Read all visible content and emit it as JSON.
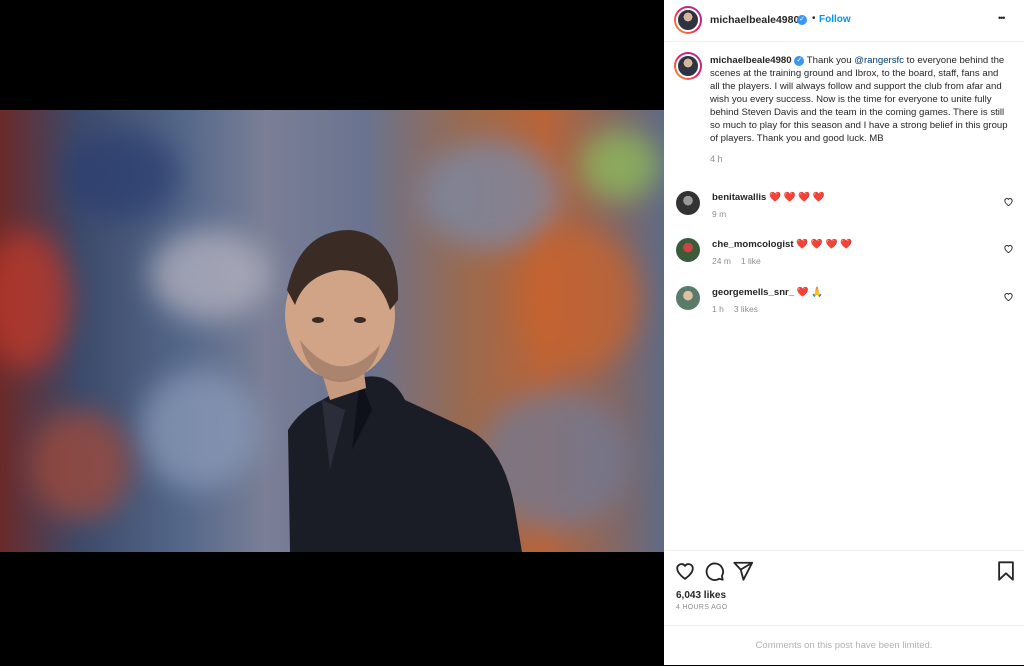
{
  "post": {
    "username": "michaelbeale4980",
    "follow_label": "Follow",
    "separator": "•",
    "more_label": "•••"
  },
  "caption": {
    "username": "michaelbeale4980",
    "pre": "Thank you ",
    "mention": "@rangersfc",
    "body": " to everyone behind the scenes at the training ground and Ibrox, to the board, staff, fans and all the players. I will always follow and support the club from afar and wish you every success. Now is the time for everyone to unite fully behind Steven Davis and the team in the coming games. There is still so much to play for this season and I have a strong belief in this group of players. Thank you and good luck. MB",
    "time": "4 h"
  },
  "comments": [
    {
      "username": "benitawallis",
      "text": "❤️ ❤️ ❤️ ❤️",
      "time": "9 m",
      "likes": ""
    },
    {
      "username": "che_momcologist",
      "text": "❤️ ❤️ ❤️ ❤️",
      "time": "24 m",
      "likes": "1 like"
    },
    {
      "username": "georgemells_snr_",
      "text": "❤️ 🙏",
      "time": "1 h",
      "likes": "3 likes"
    }
  ],
  "stats": {
    "likes": "6,043 likes",
    "ago": "4 HOURS AGO"
  },
  "footer": {
    "limited": "Comments on this post have been limited."
  },
  "colors": {
    "accent": "#0095f6",
    "heart": "#ed4956",
    "muted": "#8e8e8e"
  }
}
